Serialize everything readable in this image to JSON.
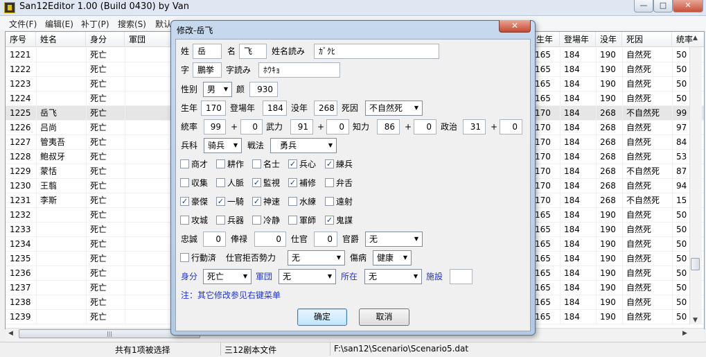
{
  "window": {
    "title": "San12Editor 1.00 (Build 0430) by Van",
    "min": "—",
    "max": "□",
    "close": "✕"
  },
  "menu": [
    "文件(F)",
    "编辑(E)",
    "补丁(P)",
    "搜索(S)",
    "默认"
  ],
  "list": {
    "left_headers": [
      "序号",
      "姓名",
      "身分",
      "軍団"
    ],
    "right_headers": [
      "生年",
      "登場年",
      "没年",
      "死因",
      "统率"
    ],
    "rows": [
      {
        "id": "1221",
        "name": "",
        "status": "死亡",
        "birth": "165",
        "appear": "184",
        "death": "190",
        "cause": "自然死",
        "lead": "50"
      },
      {
        "id": "1222",
        "name": "",
        "status": "死亡",
        "birth": "165",
        "appear": "184",
        "death": "190",
        "cause": "自然死",
        "lead": "50"
      },
      {
        "id": "1223",
        "name": "",
        "status": "死亡",
        "birth": "165",
        "appear": "184",
        "death": "190",
        "cause": "自然死",
        "lead": "50"
      },
      {
        "id": "1224",
        "name": "",
        "status": "死亡",
        "birth": "165",
        "appear": "184",
        "death": "190",
        "cause": "自然死",
        "lead": "50"
      },
      {
        "id": "1225",
        "name": "岳飞",
        "status": "死亡",
        "birth": "170",
        "appear": "184",
        "death": "268",
        "cause": "不自然死",
        "lead": "99"
      },
      {
        "id": "1226",
        "name": "吕尚",
        "status": "死亡",
        "birth": "170",
        "appear": "184",
        "death": "268",
        "cause": "自然死",
        "lead": "97"
      },
      {
        "id": "1227",
        "name": "管夷吾",
        "status": "死亡",
        "birth": "170",
        "appear": "184",
        "death": "268",
        "cause": "自然死",
        "lead": "84"
      },
      {
        "id": "1228",
        "name": "鲍叔牙",
        "status": "死亡",
        "birth": "170",
        "appear": "184",
        "death": "268",
        "cause": "自然死",
        "lead": "53"
      },
      {
        "id": "1229",
        "name": "蒙恬",
        "status": "死亡",
        "birth": "170",
        "appear": "184",
        "death": "268",
        "cause": "不自然死",
        "lead": "87"
      },
      {
        "id": "1230",
        "name": "王翦",
        "status": "死亡",
        "birth": "170",
        "appear": "184",
        "death": "268",
        "cause": "自然死",
        "lead": "94"
      },
      {
        "id": "1231",
        "name": "李斯",
        "status": "死亡",
        "birth": "170",
        "appear": "184",
        "death": "268",
        "cause": "不自然死",
        "lead": "15"
      },
      {
        "id": "1232",
        "name": "",
        "status": "死亡",
        "birth": "165",
        "appear": "184",
        "death": "190",
        "cause": "自然死",
        "lead": "50"
      },
      {
        "id": "1233",
        "name": "",
        "status": "死亡",
        "birth": "165",
        "appear": "184",
        "death": "190",
        "cause": "自然死",
        "lead": "50"
      },
      {
        "id": "1234",
        "name": "",
        "status": "死亡",
        "birth": "165",
        "appear": "184",
        "death": "190",
        "cause": "自然死",
        "lead": "50"
      },
      {
        "id": "1235",
        "name": "",
        "status": "死亡",
        "birth": "165",
        "appear": "184",
        "death": "190",
        "cause": "自然死",
        "lead": "50"
      },
      {
        "id": "1236",
        "name": "",
        "status": "死亡",
        "birth": "165",
        "appear": "184",
        "death": "190",
        "cause": "自然死",
        "lead": "50"
      },
      {
        "id": "1237",
        "name": "",
        "status": "死亡",
        "birth": "165",
        "appear": "184",
        "death": "190",
        "cause": "自然死",
        "lead": "50"
      },
      {
        "id": "1238",
        "name": "",
        "status": "死亡",
        "birth": "165",
        "appear": "184",
        "death": "190",
        "cause": "自然死",
        "lead": "50"
      },
      {
        "id": "1239",
        "name": "",
        "status": "死亡",
        "birth": "165",
        "appear": "184",
        "death": "190",
        "cause": "自然死",
        "lead": "50"
      }
    ],
    "selected_id": "1225"
  },
  "status": {
    "selection": "共有1项被选择",
    "type": "三12剧本文件",
    "path": "F:\\san12\\Scenario\\Scenario5.dat"
  },
  "dialog": {
    "title": "修改-岳飞",
    "close": "✕",
    "surname_label": "姓",
    "surname": "岳",
    "given_label": "名",
    "given": "飞",
    "name_reading_label": "姓名読み",
    "name_reading": "ｶﾞｸﾋ",
    "style_label": "字",
    "style": "鵬挙",
    "style_reading_label": "字読み",
    "style_reading": "ﾎｳｷｮ",
    "gender_label": "性别",
    "gender": "男",
    "face_label": "颜",
    "face": "930",
    "birth_label": "生年",
    "birth": "170",
    "appear_label": "登場年",
    "appear": "184",
    "death_label": "没年",
    "death": "268",
    "cause_label": "死因",
    "cause": "不自然死",
    "lead_label": "統率",
    "lead": "99",
    "lead_plus": "0",
    "war_label": "武力",
    "war": "91",
    "war_plus": "0",
    "int_label": "知力",
    "int": "86",
    "int_plus": "0",
    "pol_label": "政治",
    "pol": "31",
    "pol_plus": "0",
    "plus": "+",
    "arms_label": "兵科",
    "arms": "骑兵",
    "tactic_label": "戦法",
    "tactic": "勇兵",
    "skills": [
      [
        {
          "label": "商才",
          "checked": false
        },
        {
          "label": "耕作",
          "checked": false
        },
        {
          "label": "名士",
          "checked": false
        },
        {
          "label": "兵心",
          "checked": true
        },
        {
          "label": "練兵",
          "checked": true
        }
      ],
      [
        {
          "label": "収集",
          "checked": false
        },
        {
          "label": "人脈",
          "checked": false
        },
        {
          "label": "監視",
          "checked": true
        },
        {
          "label": "補修",
          "checked": true
        },
        {
          "label": "弁舌",
          "checked": false
        }
      ],
      [
        {
          "label": "豪傑",
          "checked": true
        },
        {
          "label": "一騎",
          "checked": true
        },
        {
          "label": "神速",
          "checked": true
        },
        {
          "label": "水練",
          "checked": false
        },
        {
          "label": "遠射",
          "checked": false
        }
      ],
      [
        {
          "label": "攻城",
          "checked": false
        },
        {
          "label": "兵器",
          "checked": false
        },
        {
          "label": "冷静",
          "checked": false
        },
        {
          "label": "軍師",
          "checked": false
        },
        {
          "label": "鬼謀",
          "checked": true
        }
      ]
    ],
    "loyalty_label": "忠誠",
    "loyalty": "0",
    "salary_label": "俸禄",
    "salary": "0",
    "service_label": "仕官",
    "service": "0",
    "rank_label": "官爵",
    "rank": "无",
    "moved_label": "行動済",
    "moved": false,
    "refuse_label": "仕官拒否勢力",
    "refuse": "无",
    "ill_label": "傷病",
    "ill": "健康",
    "status_label": "身分",
    "status": "死亡",
    "corps_label": "軍団",
    "corps": "无",
    "loc_label": "所在",
    "loc": "无",
    "facility_label": "施設",
    "facility": "",
    "note": "注：其它修改参见右键菜单",
    "ok": "确定",
    "cancel": "取消"
  }
}
